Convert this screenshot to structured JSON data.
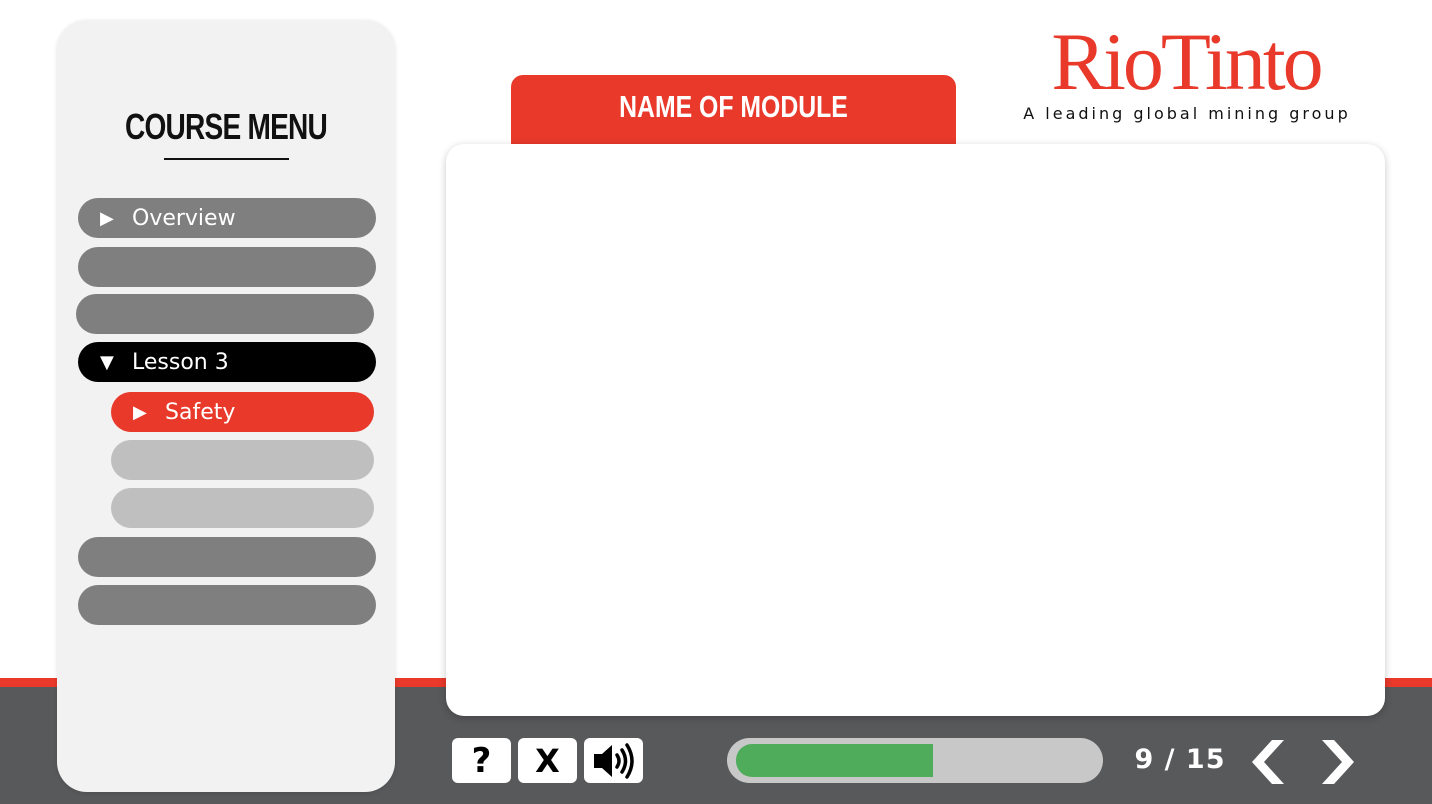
{
  "sidebar": {
    "title": "COURSE MENU",
    "items": [
      {
        "label": "Overview",
        "icon": "play-triangle-icon",
        "state": "collapsed"
      },
      {
        "label": "",
        "state": "blank"
      },
      {
        "label": "",
        "state": "blank"
      },
      {
        "label": "Lesson 3",
        "icon": "expanded-triangle-icon",
        "state": "expanded"
      },
      {
        "label": "Safety",
        "icon": "play-triangle-icon",
        "state": "active"
      },
      {
        "label": "",
        "state": "blank-sub"
      },
      {
        "label": "",
        "state": "blank-sub"
      },
      {
        "label": "",
        "state": "blank"
      },
      {
        "label": "",
        "state": "blank"
      }
    ],
    "icons": {
      "collapsed": "▶",
      "expanded": "▼"
    }
  },
  "module": {
    "title": "NAME OF MODULE"
  },
  "logo": {
    "wordmark": "RioTinto",
    "tagline": "A leading global mining group"
  },
  "controls": {
    "help_label": "?",
    "close_label": "X",
    "audio_icon": "speaker-icon"
  },
  "progress": {
    "fraction": 0.55
  },
  "pagination": {
    "current": 9,
    "total": 15,
    "display": "9 / 15"
  },
  "colors": {
    "accent_red": "#e8392b",
    "dark_gray": "#58595b",
    "progress_green": "#4fac5b",
    "menu_gray": "#7f7f7f",
    "menu_light": "#bfbfbf"
  }
}
